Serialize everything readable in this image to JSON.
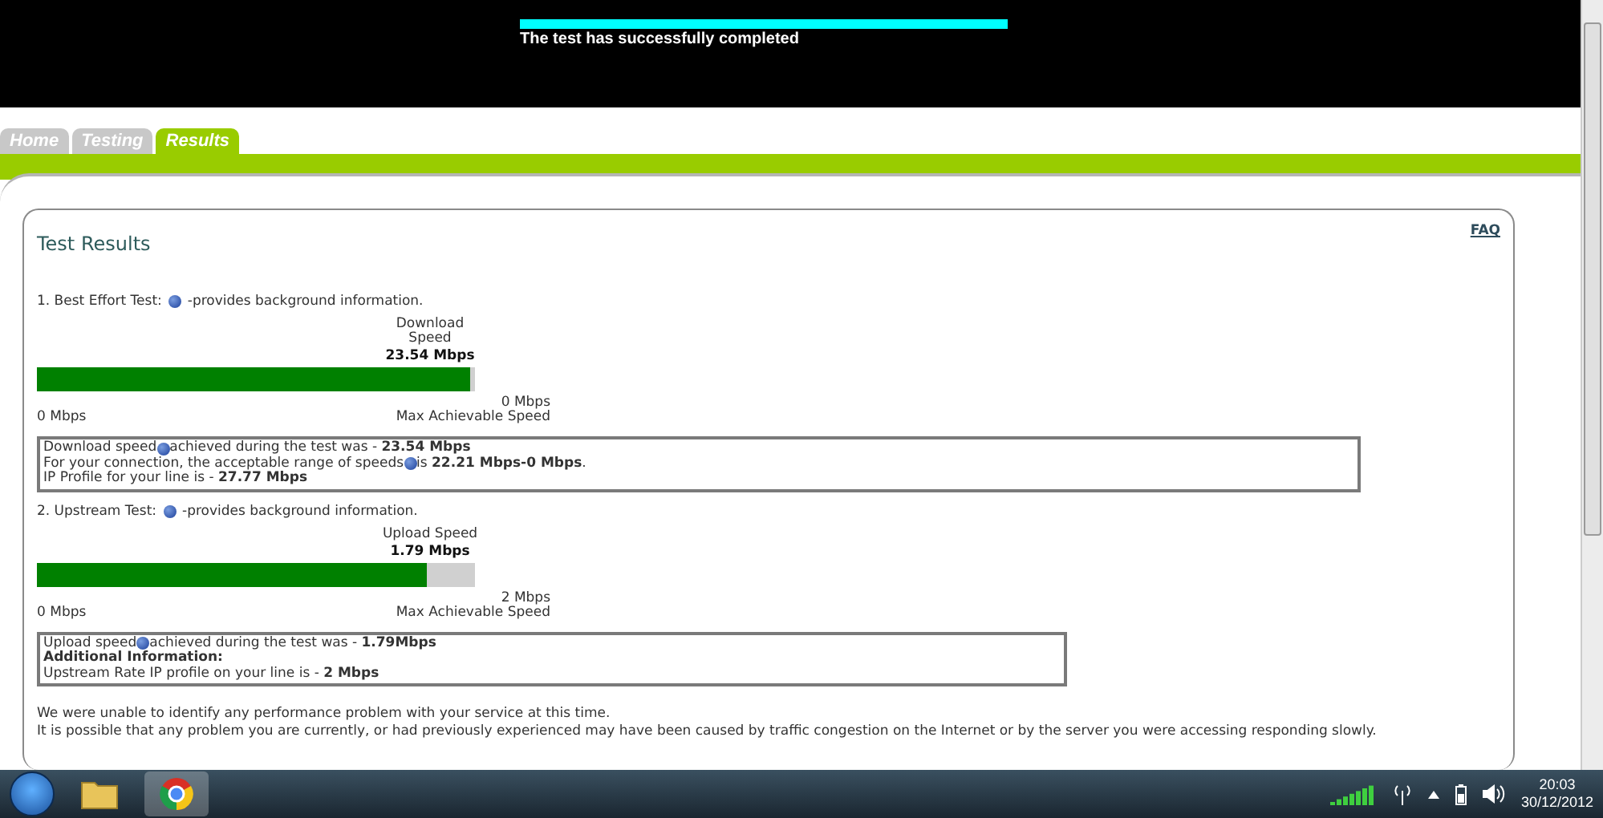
{
  "header": {
    "progress": {
      "level": 1
    },
    "status": "The test has successfully completed"
  },
  "tabs": [
    {
      "label": "Home",
      "selected": false
    },
    {
      "label": "Testing",
      "selected": false
    },
    {
      "label": "Results",
      "selected": true
    }
  ],
  "panel": {
    "title": "Test Results",
    "faq": "FAQ",
    "sections": [
      {
        "heading_before": "1. Best Effort Test:",
        "heading_after": "-provides background information.",
        "caption": [
          "Download",
          "Speed"
        ],
        "reading": "23.54 Mbps",
        "level": 0.99,
        "min": "0 Mbps",
        "max": "0 Mbps",
        "max_label": "Max Achievable Speed",
        "box_wide": true,
        "info": [
          {
            "before": "Download speed",
            "help": true,
            "after": "achieved during the test was - **23.54 Mbps**"
          },
          {
            "before": "For your connection, the acceptable range of speeds",
            "help": true,
            "after": " is **22.21 Mbps-0 Mbps**."
          },
          {
            "before": "IP Profile for your line is - **27.77 Mbps**",
            "help": false
          }
        ]
      },
      {
        "heading_before": "2. Upstream Test:",
        "heading_after": "-provides background information.",
        "caption": [
          "Upload Speed"
        ],
        "reading": "1.79 Mbps",
        "level": 0.89,
        "min": "0 Mbps",
        "max": "2 Mbps",
        "max_label": "Max Achievable Speed",
        "box_wide": false,
        "info": [
          {
            "before": "Upload speed",
            "help": true,
            "after": " achieved during the test was - **1.79Mbps**"
          },
          {
            "before": " **Additional Information:**",
            "help": false
          },
          {
            "before": " Upstream Rate IP profile on your line is - **2 Mbps**",
            "help": false
          }
        ]
      }
    ],
    "notes": [
      "We were unable to identify any performance problem with your service at this time.",
      "It is possible that any problem you are currently, or had previously experienced may have been caused by traffic congestion on the Internet or by the server you were accessing responding slowly."
    ]
  },
  "taskbar": {
    "time": "20:03",
    "date": "30/12/2012"
  }
}
